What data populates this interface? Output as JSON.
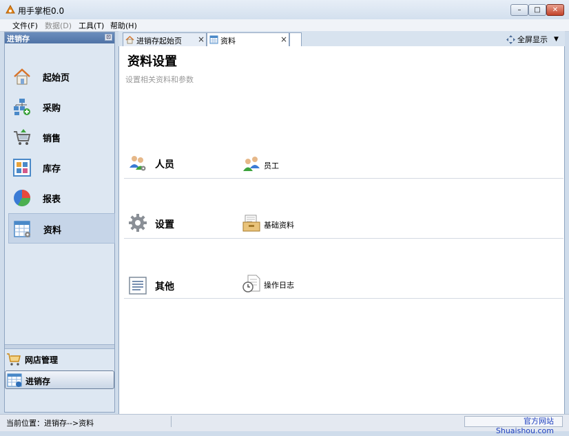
{
  "window": {
    "title": "用手掌柜0.0",
    "min": "–",
    "max": "□",
    "close": "✕"
  },
  "menu": [
    "文件(F)",
    "数据(D)",
    "工具(T)",
    "帮助(H)"
  ],
  "left_panel": {
    "header": "进销存",
    "pin": "⊡",
    "nav": [
      {
        "label": "起始页",
        "icon": "home-icon"
      },
      {
        "label": "采购",
        "icon": "purchase-icon"
      },
      {
        "label": "销售",
        "icon": "sales-cart-icon"
      },
      {
        "label": "库存",
        "icon": "inventory-icon"
      },
      {
        "label": "报表",
        "icon": "pie-chart-icon"
      },
      {
        "label": "资料",
        "icon": "data-table-icon"
      }
    ],
    "bottom": [
      {
        "label": "网店管理",
        "icon": "cart-icon"
      },
      {
        "label": "进销存",
        "icon": "ledger-icon"
      }
    ]
  },
  "tabs": [
    {
      "label": "进销存起始页",
      "close": "×"
    },
    {
      "label": "资料",
      "close": "×"
    }
  ],
  "fullscreen_label": "全屏显示",
  "page": {
    "title": "资料设置",
    "subtitle": "设置相关资料和参数",
    "sections": [
      {
        "title": "人员",
        "items": [
          {
            "label": "员工"
          }
        ]
      },
      {
        "title": "设置",
        "items": [
          {
            "label": "基础资料"
          }
        ]
      },
      {
        "title": "其他",
        "items": [
          {
            "label": "操作日志"
          }
        ]
      }
    ]
  },
  "status": {
    "location": "当前位置：进销存-->资料",
    "site": "官方网站 Shuaishou.com"
  },
  "colors": {
    "accent": "#4f73a6",
    "link": "#1d3fbf"
  }
}
